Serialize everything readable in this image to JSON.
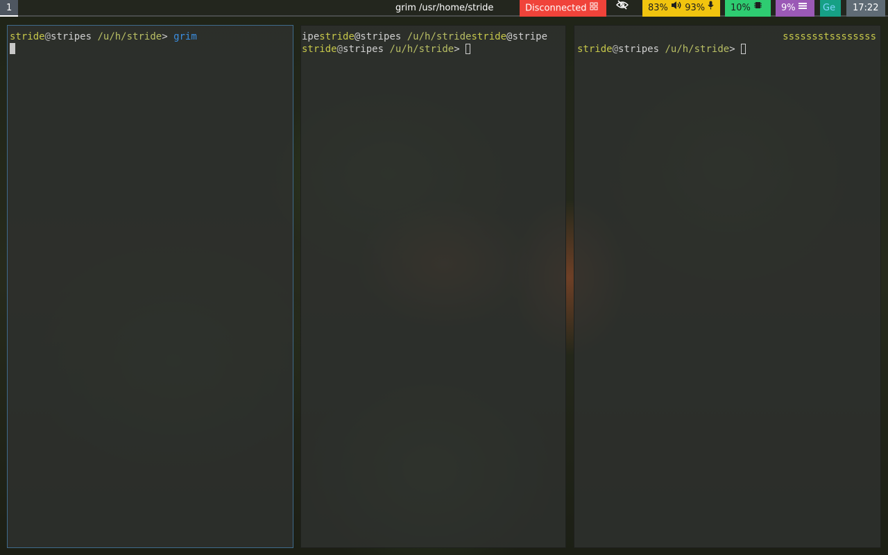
{
  "bar": {
    "workspace": "1",
    "window_title": "grim /usr/home/stride",
    "network": "Disconnected",
    "network_icon": "network-disconnected-icon",
    "idle_icon": "eye-slash-icon",
    "volume": "83%",
    "volume_icon": "speaker-icon",
    "mic": "93%",
    "mic_icon": "microphone-icon",
    "cpu": "10%",
    "cpu_icon": "cpu-chip-icon",
    "memory": "9%",
    "memory_icon": "memory-bars-icon",
    "language": "Ge",
    "clock": "17:22",
    "colors": {
      "network": "#f0433a",
      "audio": "#f1c40f",
      "cpu": "#2ecc71",
      "memory": "#9b59b6",
      "language": "#16a085",
      "clock": "#5f6b75"
    }
  },
  "terminals": [
    {
      "focused": true,
      "prompt": {
        "user": "stride",
        "at": "@",
        "host": "stripes",
        "path": "/u/h/stride",
        "symbol": ">"
      },
      "command": "grim"
    },
    {
      "focused": false,
      "wrap_line": {
        "a": "ipe",
        "b": "stride",
        "c": "@stripes ",
        "d": "/u/h/stride",
        "e": "stride",
        "f": "@stripe"
      },
      "prompt": {
        "user": "stride",
        "at": "@",
        "host": "stripes",
        "path": "/u/h/stride",
        "symbol": ">"
      }
    },
    {
      "focused": false,
      "right_prompt": "ssssssstssssssss",
      "prompt": {
        "user": "stride",
        "at": "@",
        "host": "stripes",
        "path": "/u/h/stride",
        "symbol": ">"
      }
    }
  ]
}
